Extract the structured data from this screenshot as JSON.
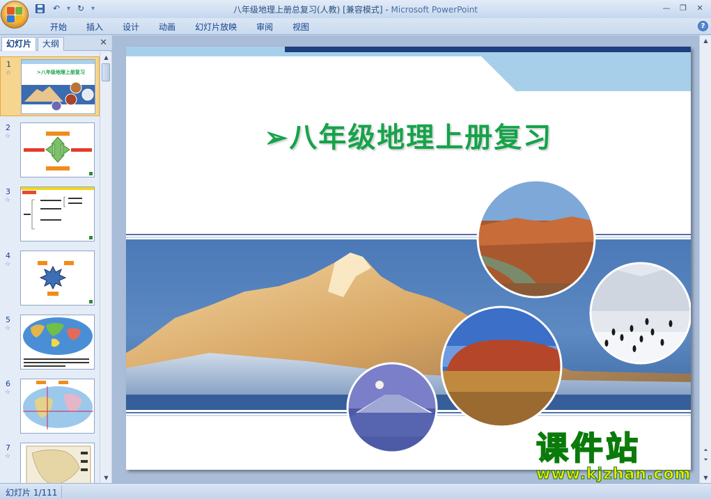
{
  "window": {
    "title_doc": "八年级地理上册总复习(人教) [兼容模式] - ",
    "title_app": "Microsoft PowerPoint"
  },
  "ribbon": {
    "tabs": [
      "开始",
      "插入",
      "设计",
      "动画",
      "幻灯片放映",
      "审阅",
      "视图"
    ],
    "help": "?"
  },
  "left_pane": {
    "tab_slides": "幻灯片",
    "tab_outline": "大纲",
    "close": "✕",
    "slides": [
      {
        "num": "1",
        "selected": true
      },
      {
        "num": "2",
        "selected": false
      },
      {
        "num": "3",
        "selected": false
      },
      {
        "num": "4",
        "selected": false
      },
      {
        "num": "5",
        "selected": false
      },
      {
        "num": "6",
        "selected": false
      },
      {
        "num": "7",
        "selected": false
      }
    ],
    "anim_marker": "☆"
  },
  "slide": {
    "title": "➢八年级地理上册复习"
  },
  "watermark": {
    "title": "课件站",
    "url": "www.kjzhan.com"
  },
  "statusbar": {
    "slide_info": "幻灯片 1/111"
  },
  "colors": {
    "title_green": "#16a34a",
    "slide_band_blue": "#2f5fa0",
    "selected_thumb": "#f6d58e"
  }
}
